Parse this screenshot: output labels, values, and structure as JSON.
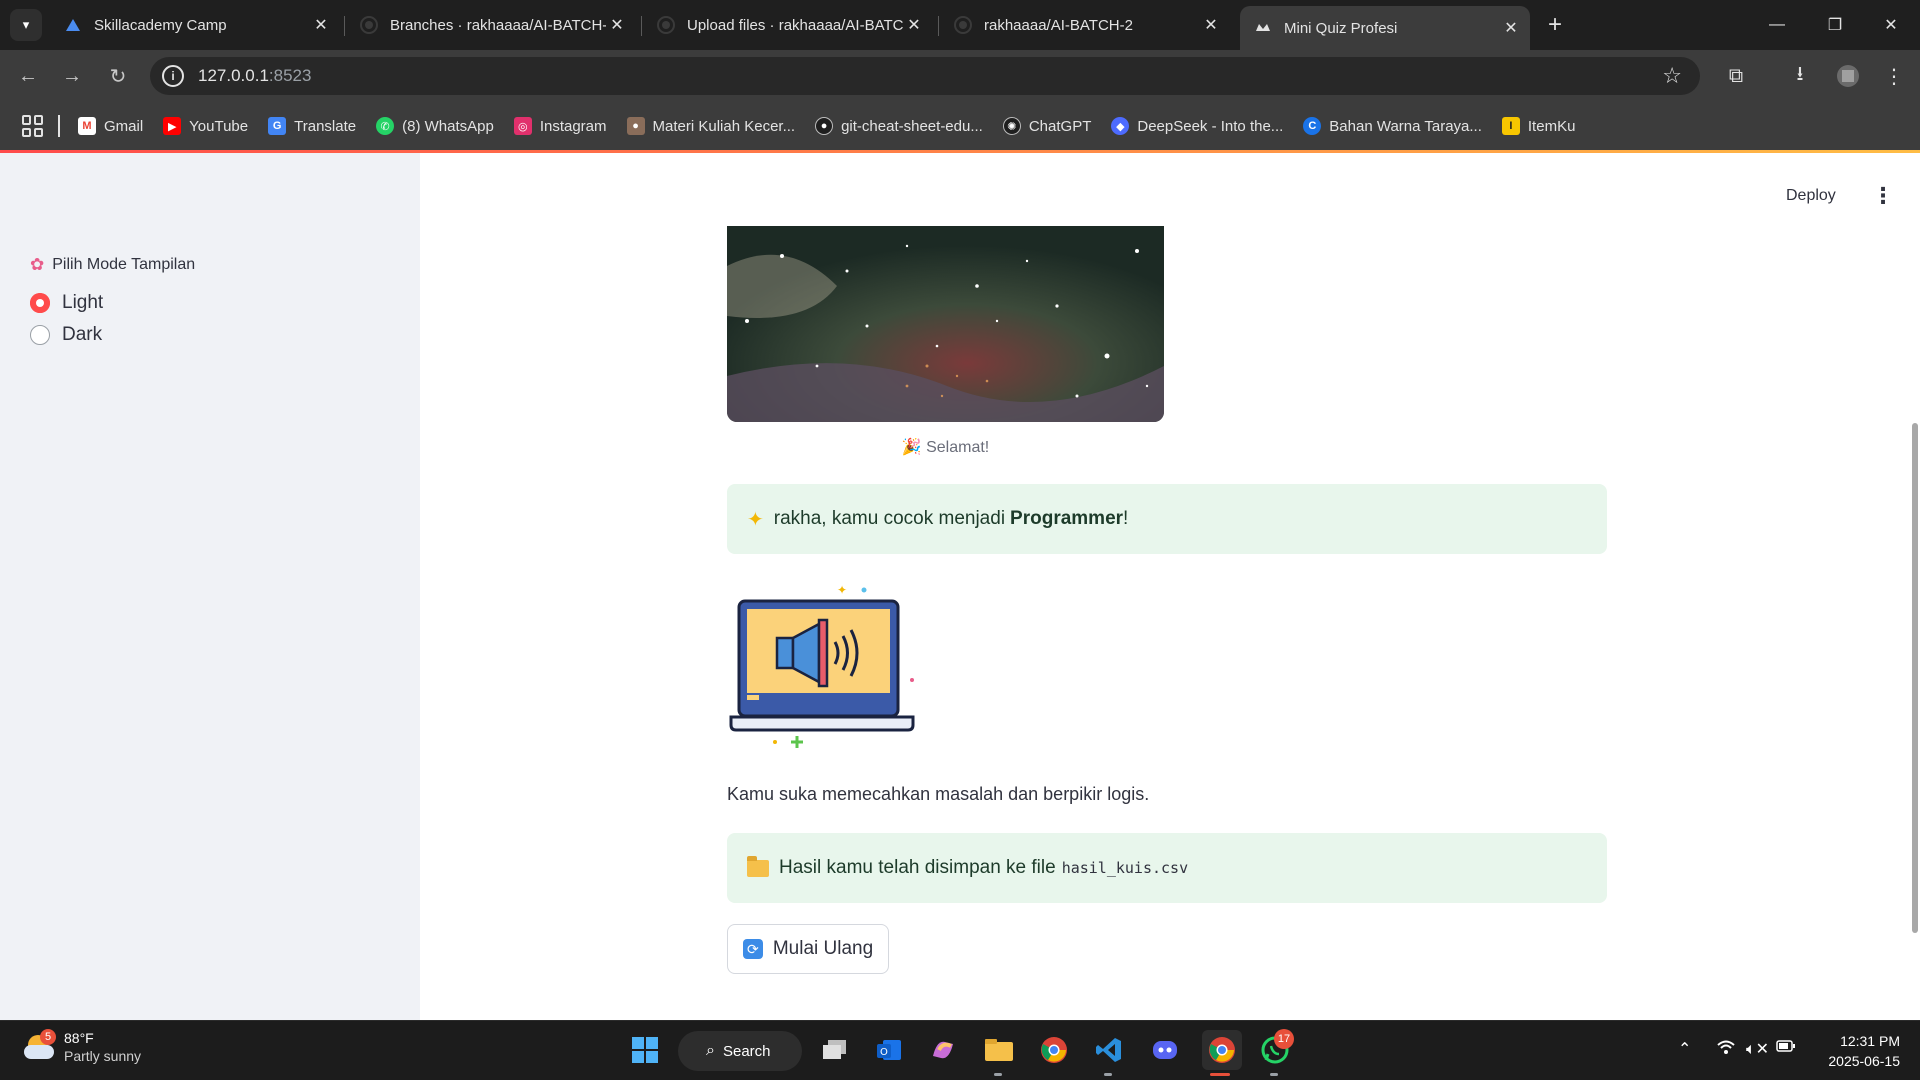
{
  "browser": {
    "tabs": [
      {
        "label": "Skillacademy Camp",
        "icon": "skillacademy-icon"
      },
      {
        "label": "Branches · rakhaaaa/AI-BATCH-",
        "icon": "github-icon"
      },
      {
        "label": "Upload files · rakhaaaa/AI-BATC",
        "icon": "github-icon"
      },
      {
        "label": "rakhaaaa/AI-BATCH-2",
        "icon": "github-icon"
      },
      {
        "label": "Mini Quiz Profesi",
        "icon": "streamlit-icon",
        "active": true
      }
    ],
    "address": {
      "host": "127.0.0.1",
      "port": ":8523"
    },
    "bookmarks": [
      {
        "label": "Gmail",
        "icon": "gmail-icon",
        "color": "#ea4335"
      },
      {
        "label": "YouTube",
        "icon": "youtube-icon",
        "color": "#ff0000"
      },
      {
        "label": "Translate",
        "icon": "translate-icon",
        "color": "#4285f4"
      },
      {
        "label": "(8) WhatsApp",
        "icon": "whatsapp-icon",
        "color": "#25d366"
      },
      {
        "label": "Instagram",
        "icon": "instagram-icon",
        "color": "#e1306c"
      },
      {
        "label": "Materi Kuliah Kecer...",
        "icon": "person-icon",
        "color": "#8a6d5a"
      },
      {
        "label": "git-cheat-sheet-edu...",
        "icon": "github-icon",
        "color": "#1f1f1f"
      },
      {
        "label": "ChatGPT",
        "icon": "chatgpt-icon",
        "color": "#1f1f1f"
      },
      {
        "label": "DeepSeek - Into the...",
        "icon": "deepseek-icon",
        "color": "#4d6bfe"
      },
      {
        "label": "Bahan Warna Taraya...",
        "icon": "canva-icon",
        "color": "#1a73e8"
      },
      {
        "label": "ItemKu",
        "icon": "itemku-icon",
        "color": "#f7c600"
      }
    ]
  },
  "sidebar": {
    "title": "Pilih Mode Tampilan",
    "options": [
      {
        "label": "Light",
        "selected": true
      },
      {
        "label": "Dark",
        "selected": false
      }
    ]
  },
  "main": {
    "deploy_label": "Deploy",
    "caption": "🎉 Selamat!",
    "result": {
      "prefix": "rakha, kamu cocok menjadi",
      "profession": "Programmer",
      "suffix": "!"
    },
    "description": "Kamu suka memecahkan masalah dan berpikir logis.",
    "saved": {
      "text": "Hasil kamu telah disimpan ke file",
      "filename": "hasil_kuis.csv"
    },
    "restart_label": "Mulai Ulang"
  },
  "taskbar": {
    "weather": {
      "temp": "88°F",
      "condition": "Partly sunny",
      "badge": "5"
    },
    "search_label": "Search",
    "whatsapp_badge": "17",
    "time": "12:31 PM",
    "date": "2025-06-15"
  },
  "colors": {
    "accent": "#ff4b4b",
    "success_bg": "#e8f6ec",
    "sidebar_bg": "#f0f2f6"
  }
}
